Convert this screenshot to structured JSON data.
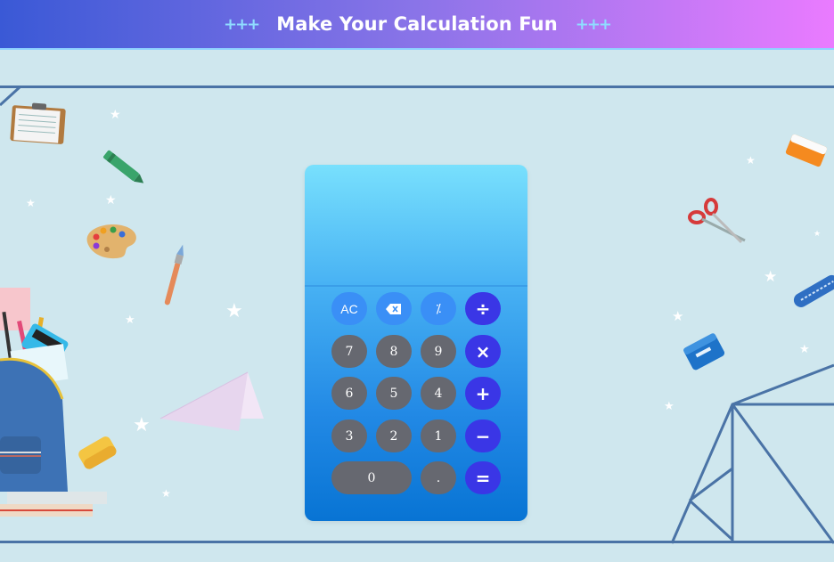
{
  "header": {
    "title": "Make Your Calculation Fun",
    "deco_left": "+++",
    "deco_right": "+++"
  },
  "calculator": {
    "display": "",
    "keys": {
      "clear": "AC",
      "backspace_icon": "backspace-icon",
      "percent": "⁒",
      "divide": "÷",
      "seven": "7",
      "eight": "8",
      "nine": "9",
      "multiply": "×",
      "six": "6",
      "five": "5",
      "four": "4",
      "add": "+",
      "three": "3",
      "two": "2",
      "one": "1",
      "subtract": "−",
      "zero": "0",
      "decimal": ".",
      "equals": "="
    }
  },
  "colors": {
    "header_gradient": [
      "#3a59d6",
      "#ea7bff"
    ],
    "background": "#cfe7ee",
    "number_key": "#666870",
    "function_key": "#3a8ff6",
    "operator_key": "#3a36e6"
  },
  "decorations": [
    "clipboard-icon",
    "crayon-icon",
    "paint-palette-icon",
    "paintbrush-icon",
    "school-bag-icon",
    "paper-plane-icon",
    "eraser-icon",
    "scissors-icon",
    "pencil-case-icon",
    "sharpener-icon",
    "set-square-icon"
  ]
}
